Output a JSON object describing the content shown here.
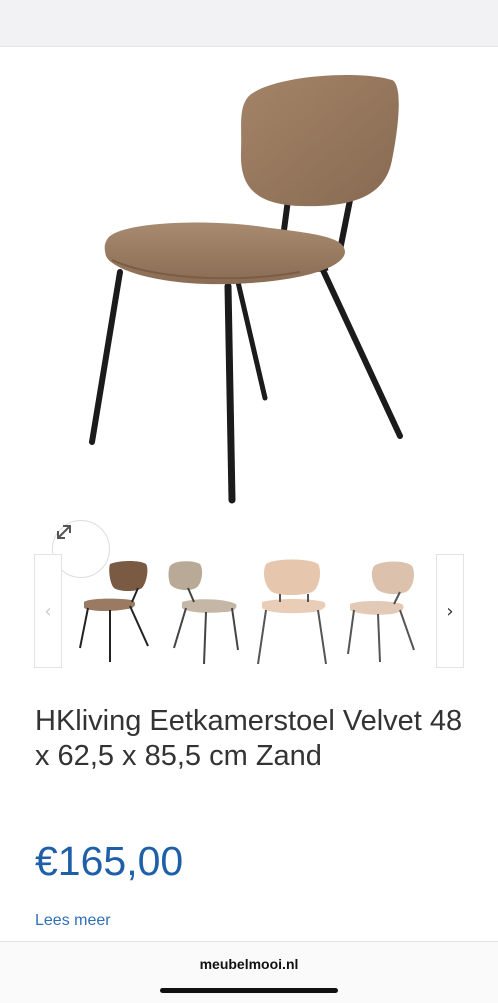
{
  "product": {
    "title": "HKliving Eetkamerstoel Velvet 48 x 62,5 x 85,5 cm Zand",
    "price": "€165,00",
    "read_more_label": "Lees meer"
  },
  "gallery": {
    "prev_arrow": "‹",
    "next_arrow": "›",
    "expand_icon": "expand-arrows-icon",
    "thumbnails": [
      {
        "color": "#7a5a42"
      },
      {
        "color": "#b9aa98"
      },
      {
        "color": "#e6c6ad"
      },
      {
        "color": "#dcc2ac"
      }
    ]
  },
  "browser": {
    "url": "meubelmooi.nl"
  },
  "colors": {
    "price": "#1e5fa8",
    "link": "#2f6fb7",
    "chair_main": "#96765c"
  }
}
